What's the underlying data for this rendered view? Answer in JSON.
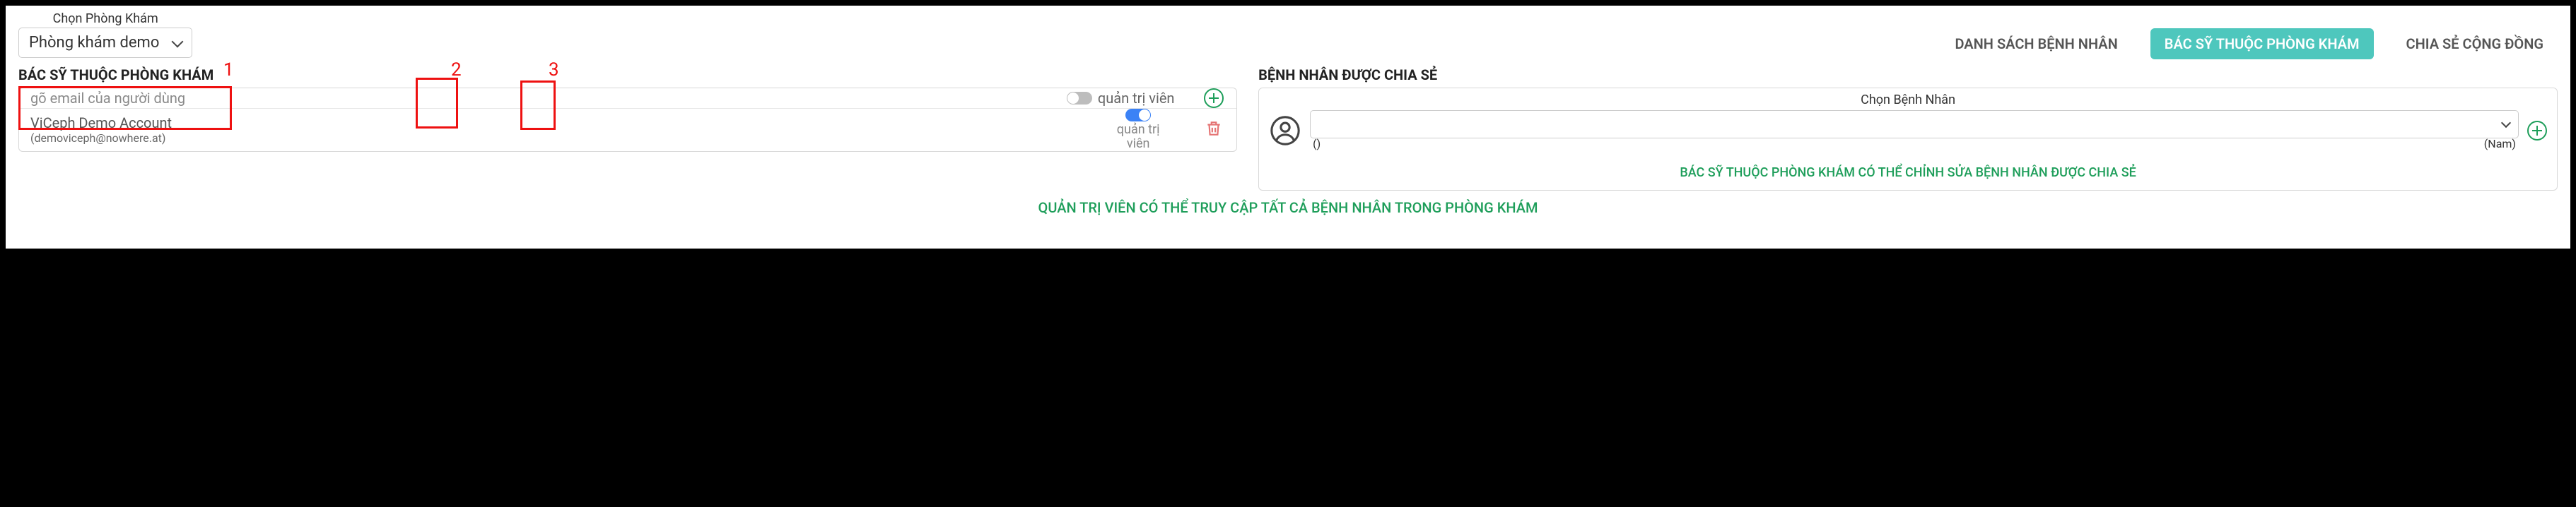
{
  "clinic": {
    "label": "Chọn Phòng Khám",
    "selected": "Phòng khám demo"
  },
  "tabs": {
    "patients": "DANH SÁCH BỆNH NHÂN",
    "doctors": "BÁC SỸ THUỘC PHÒNG KHÁM",
    "community": "CHIA SẺ CỘNG ĐỒNG"
  },
  "left": {
    "title": "BÁC SỸ THUỘC PHÒNG KHÁM",
    "email_placeholder": "gõ email của người dùng",
    "toggle_label": "quản trị viên",
    "rows": [
      {
        "name": "ViCeph Demo Account",
        "email": "(demoviceph@nowhere.at)",
        "role_label": "quản trị viên"
      }
    ]
  },
  "right": {
    "title": "BỆNH NHÂN ĐƯỢC CHIA SẺ",
    "choose_label": "Chọn Bệnh Nhân",
    "age_empty": "()",
    "gender": "(Nam)",
    "note": "BÁC SỸ THUỘC PHÒNG KHÁM CÓ THỂ CHỈNH SỬA BỆNH NHÂN ĐƯỢC CHIA SẺ"
  },
  "footer": "QUẢN TRỊ VIÊN CÓ THỂ TRUY CẬP TẤT CẢ BỆNH NHÂN TRONG PHÒNG KHÁM",
  "annotations": {
    "n1": "1",
    "n2": "2",
    "n3": "3"
  }
}
